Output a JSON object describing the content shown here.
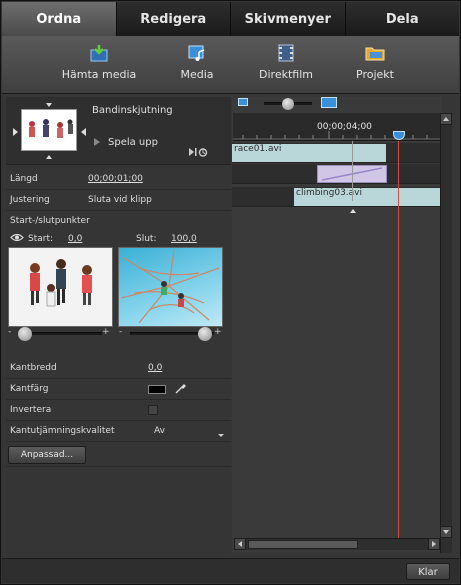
{
  "tabs": [
    {
      "label": "Ordna",
      "active": true
    },
    {
      "label": "Redigera",
      "active": false
    },
    {
      "label": "Skivmenyer",
      "active": false
    },
    {
      "label": "Dela",
      "active": false
    }
  ],
  "toolbar": {
    "items": [
      {
        "label": "Hämta media",
        "icon": "get-media-icon"
      },
      {
        "label": "Media",
        "icon": "media-icon"
      },
      {
        "label": "Direktfilm",
        "icon": "instant-movie-icon"
      },
      {
        "label": "Projekt",
        "icon": "project-icon"
      }
    ]
  },
  "transition": {
    "name": "Bandinskjutning",
    "play_label": "Spela upp"
  },
  "properties": {
    "length_label": "Längd",
    "length_value": "00;00;01;00",
    "alignment_label": "Justering",
    "alignment_value": "Sluta vid klipp",
    "startend_label": "Start-/slutpunkter",
    "start_label": "Start:",
    "start_value": "0,0",
    "end_label": "Slut:",
    "end_value": "100,0",
    "border_width_label": "Kantbredd",
    "border_width_value": "0,0",
    "border_color_label": "Kantfärg",
    "border_color_value": "#000000",
    "invert_label": "Invertera",
    "invert_checked": false,
    "antialias_label": "Kantutjämningskvalitet",
    "antialias_value": "Av",
    "custom_button": "Anpassad..."
  },
  "timeline": {
    "timecode": "00;00;04;00",
    "clip1_label": "race01.avi",
    "clip2_label": "climbing03.avi"
  },
  "footer": {
    "done_button": "Klar"
  },
  "colors": {
    "accent_blue": "#3a8fd8",
    "playhead": "#d84a4a",
    "clip_teal": "#b9d7d8",
    "clip_purple": "#d2c6e6"
  }
}
